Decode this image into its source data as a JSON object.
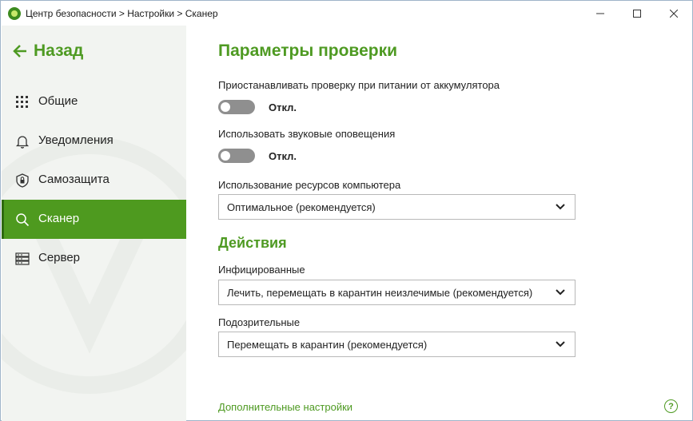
{
  "window": {
    "title": "Центр безопасности > Настройки > Сканер",
    "controls": [
      "minimize",
      "maximize",
      "close"
    ]
  },
  "sidebar": {
    "back_label": "Назад",
    "items": [
      {
        "label": "Общие",
        "icon": "grid-icon",
        "active": false
      },
      {
        "label": "Уведомления",
        "icon": "bell-icon",
        "active": false
      },
      {
        "label": "Самозащита",
        "icon": "shield-icon",
        "active": false
      },
      {
        "label": "Сканер",
        "icon": "search-icon",
        "active": true
      },
      {
        "label": "Сервер",
        "icon": "server-icon",
        "active": false
      }
    ]
  },
  "main": {
    "section_title": "Параметры проверки",
    "battery": {
      "label": "Приостанавливать проверку при питании от аккумулятора",
      "state": "Откл."
    },
    "sound": {
      "label": "Использовать звуковые оповещения",
      "state": "Откл."
    },
    "resources": {
      "label": "Использование ресурсов компьютера",
      "value": "Оптимальное (рекомендуется)"
    },
    "actions_title": "Действия",
    "infected": {
      "label": "Инфицированные",
      "value": "Лечить, перемещать в карантин неизлечимые (рекомендуется)"
    },
    "suspicious": {
      "label": "Подозрительные",
      "value": "Перемещать в карантин (рекомендуется)"
    },
    "more_link": "Дополнительные настройки",
    "help_glyph": "?"
  },
  "colors": {
    "accent": "#4e9a22",
    "active_nav": "#4e9a1f",
    "sidebar_bg": "#f2f4f1",
    "toggle_off": "#8f8f8f"
  }
}
